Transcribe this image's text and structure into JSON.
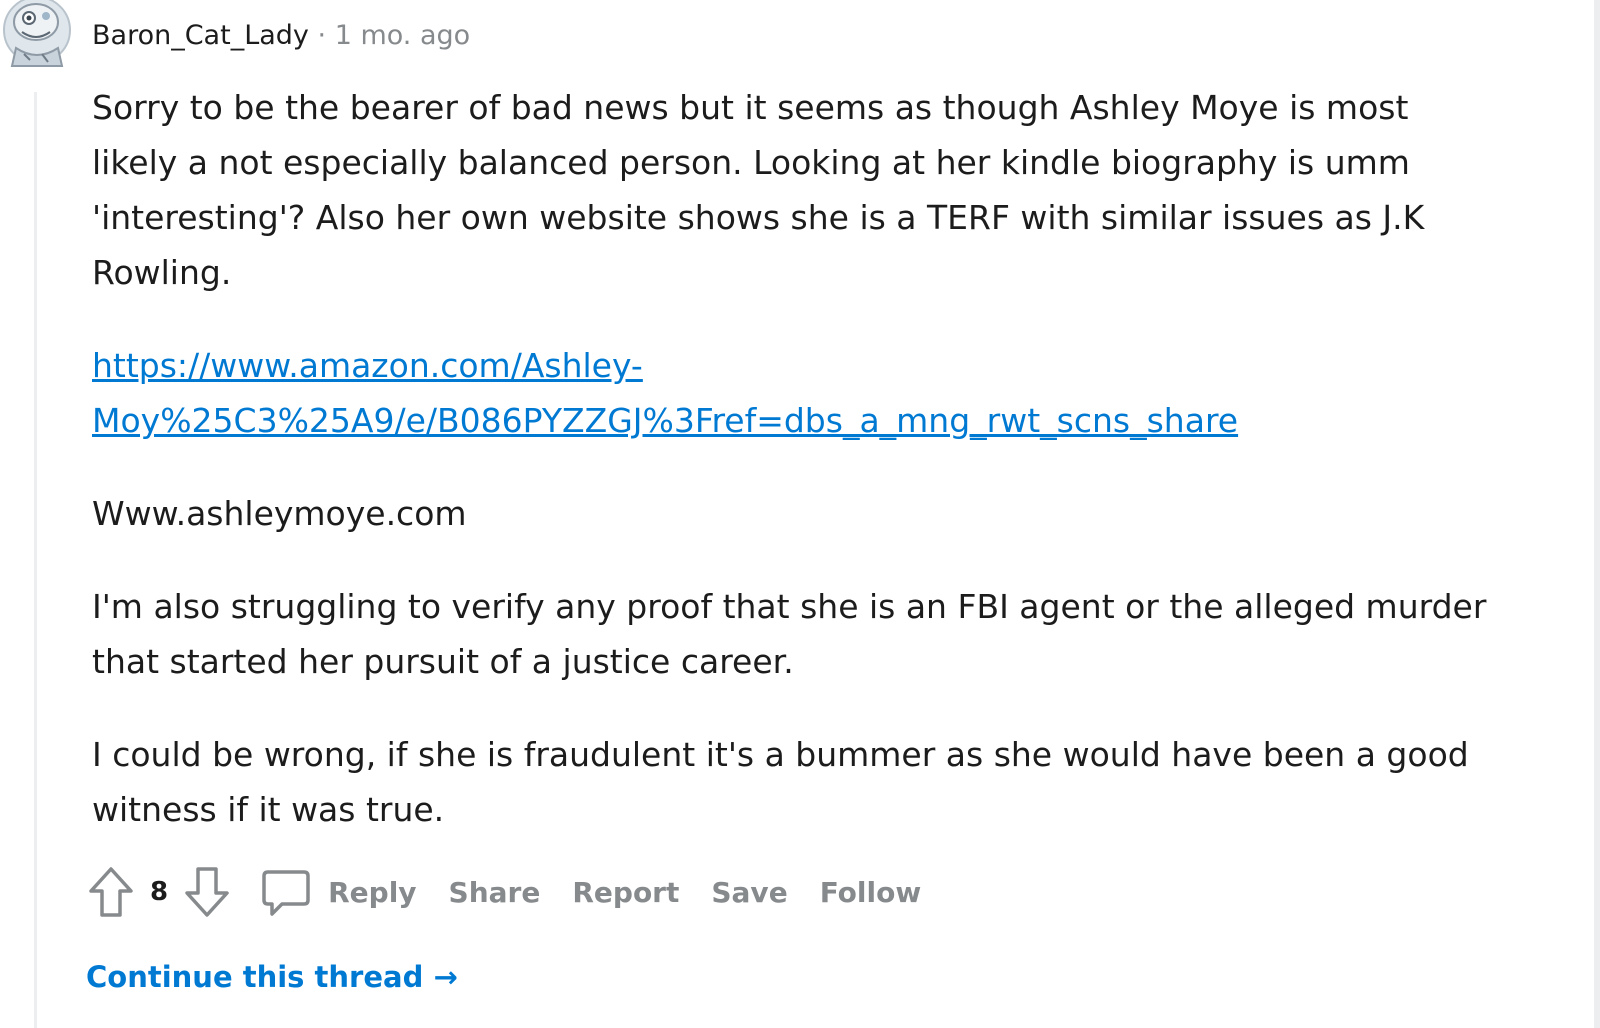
{
  "comment": {
    "author": "Baron_Cat_Lady",
    "separator": "·",
    "time": "1 mo. ago",
    "paragraphs": [
      "Sorry to be the bearer of bad news but it seems as though Ashley Moye is most likely a not especially balanced person. Looking at her kindle biography is umm 'interesting'? Also her own website shows she is a TERF with similar issues as J.K Rowling.",
      "Www.ashleymoye.com",
      "I'm also struggling to verify any proof that she is an FBI agent or the alleged murder that started her pursuit of a justice career.",
      "I could be wrong, if she is fraudulent it's a bummer as she would have been a good witness if it was true."
    ],
    "link_line1": "https://www.amazon.com/Ashley-",
    "link_line2": "Moy%25C3%25A9/e/B086PYZZGJ%3Fref=dbs_a_mng_rwt_scns_share"
  },
  "actions": {
    "vote_count": "8",
    "reply": "Reply",
    "share": "Share",
    "report": "Report",
    "save": "Save",
    "follow": "Follow"
  },
  "thread": {
    "continue_label": "Continue this thread",
    "arrow": "→"
  },
  "icons": {
    "upvote": "upvote-icon",
    "downvote": "downvote-icon",
    "comment": "comment-icon",
    "avatar": "avatar"
  },
  "colors": {
    "link": "#0079d3",
    "muted": "#878a8c",
    "text": "#1c1c1c",
    "thread_line": "#eceef0"
  }
}
